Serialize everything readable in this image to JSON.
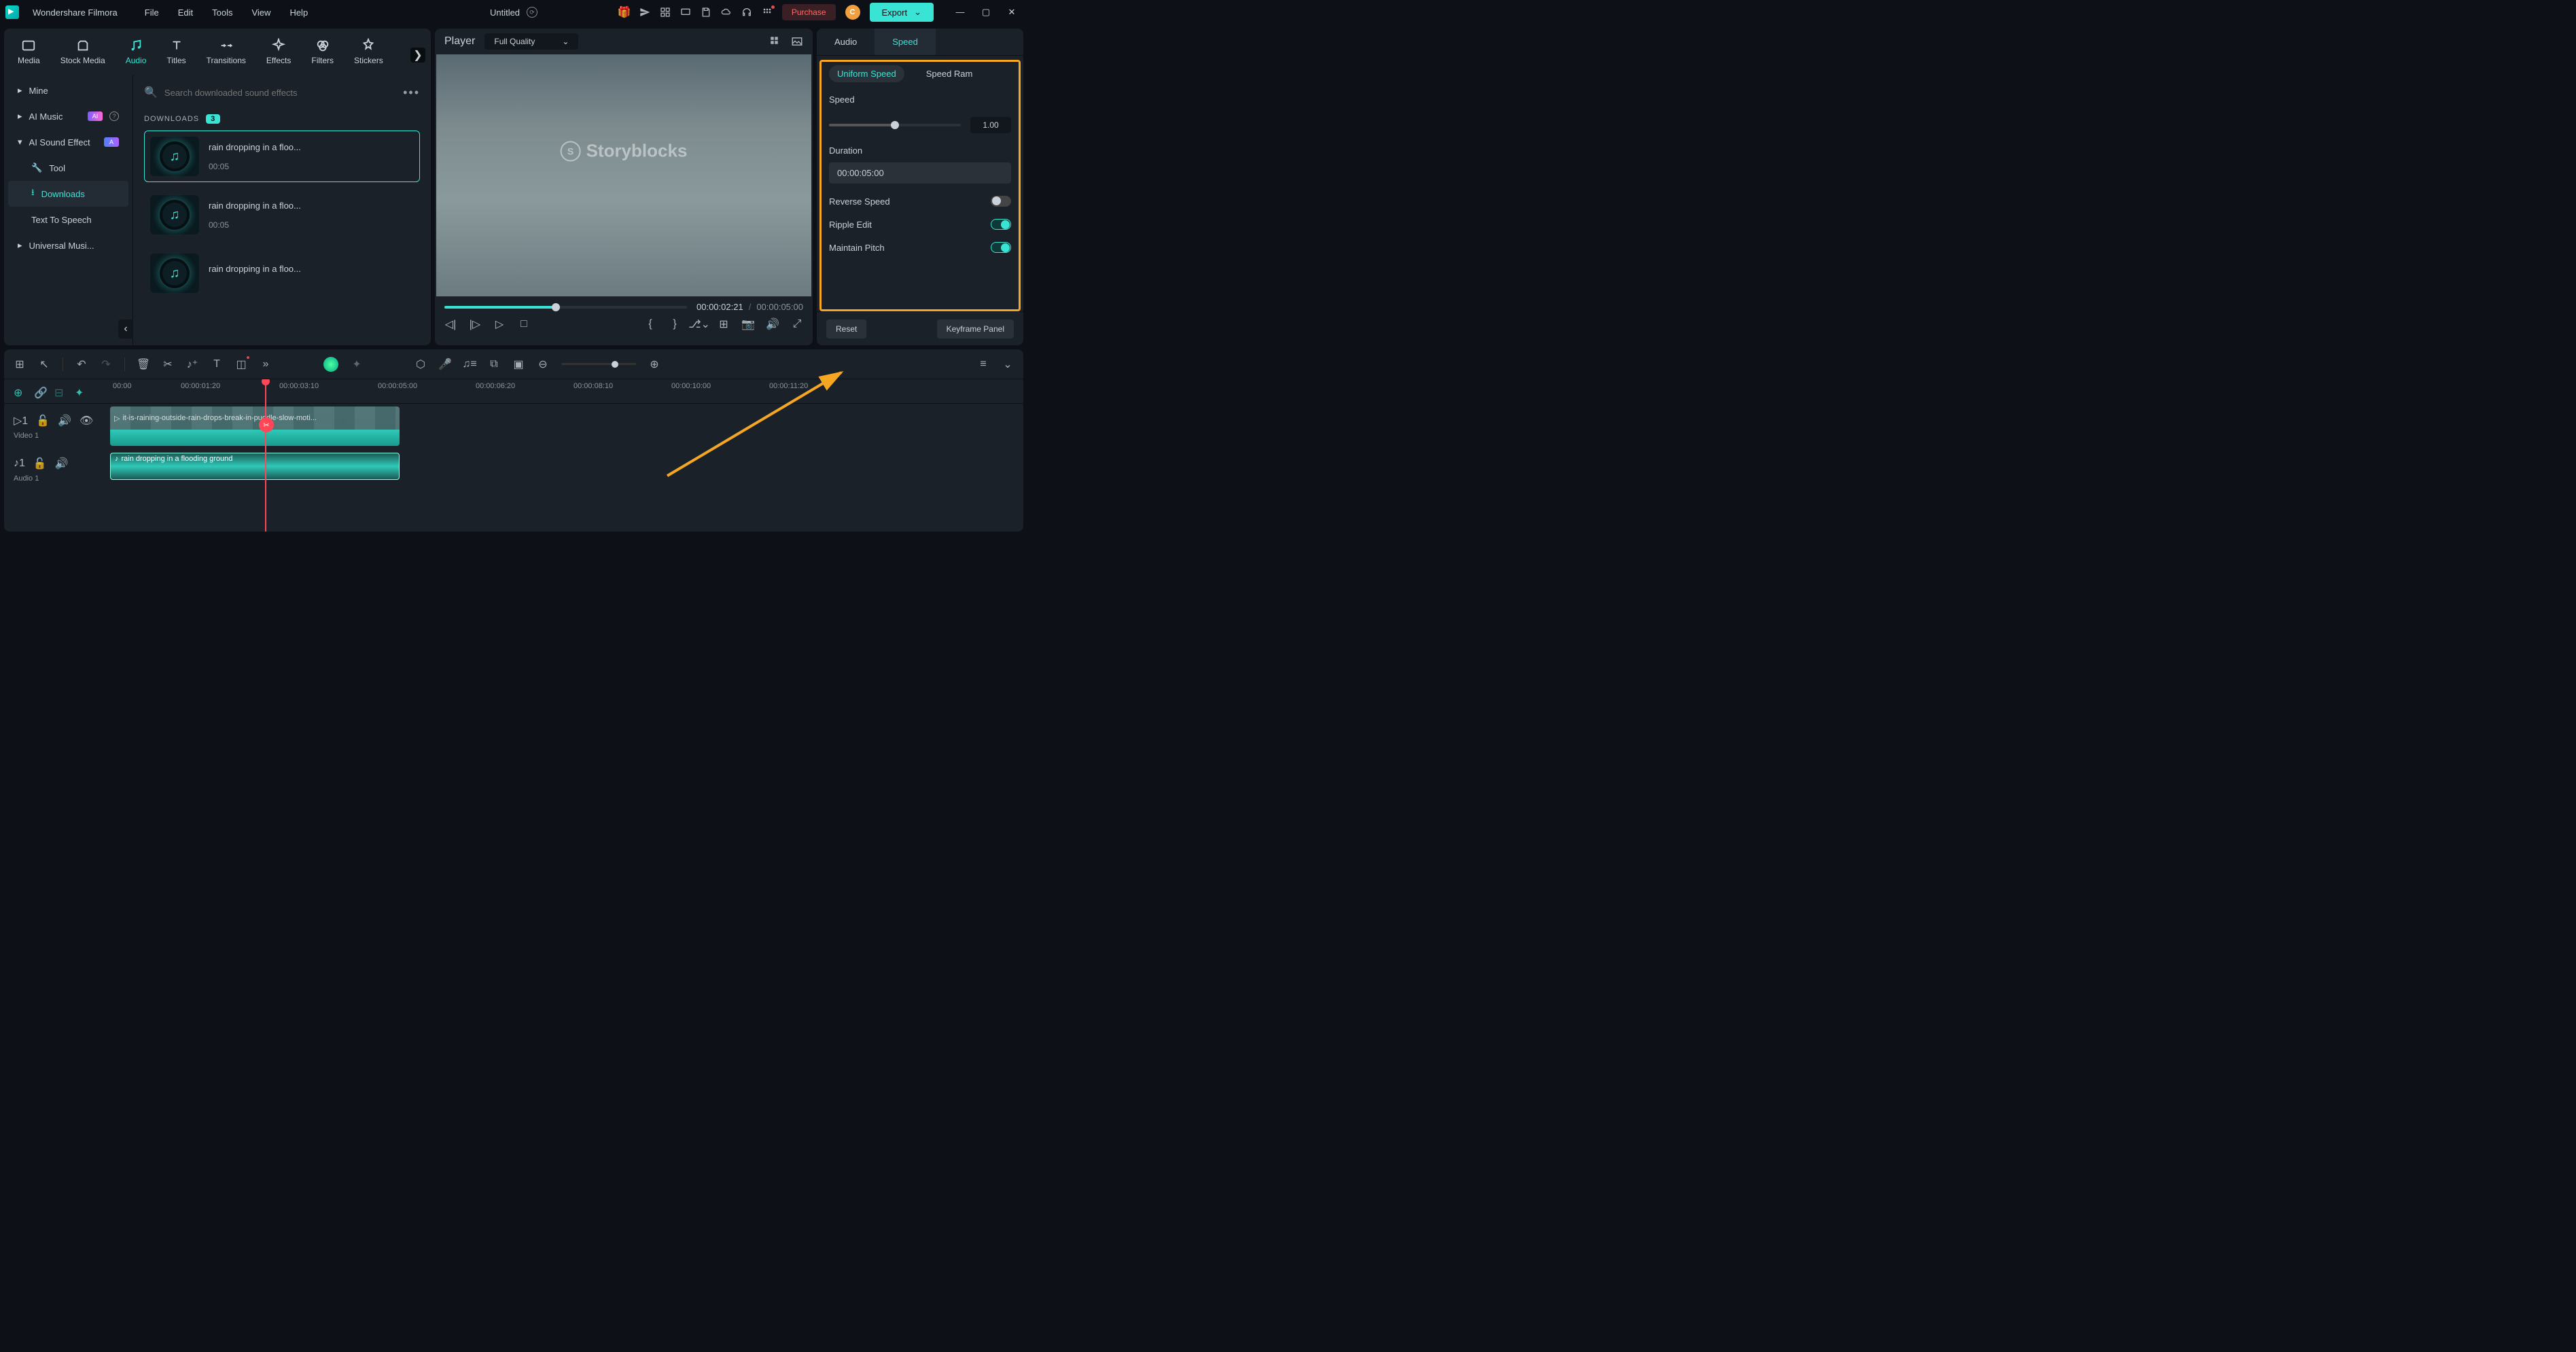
{
  "app_name": "Wondershare Filmora",
  "menus": [
    "File",
    "Edit",
    "Tools",
    "View",
    "Help"
  ],
  "doc_title": "Untitled",
  "titlebar_buttons": {
    "purchase": "Purchase",
    "export": "Export",
    "avatar_letter": "C"
  },
  "library_tabs": [
    "Media",
    "Stock Media",
    "Audio",
    "Titles",
    "Transitions",
    "Effects",
    "Filters",
    "Stickers"
  ],
  "library_active_tab": "Audio",
  "sidebar": {
    "items": [
      {
        "label": "Mine",
        "type": "arrow"
      },
      {
        "label": "AI Music",
        "type": "arrow",
        "badge": "AI",
        "help": true
      },
      {
        "label": "AI Sound Effect",
        "type": "arrow",
        "badge": "A",
        "expanded": true
      },
      {
        "label": "Tool",
        "type": "sub",
        "icon": "wrench"
      },
      {
        "label": "Downloads",
        "type": "sub",
        "icon": "download",
        "active": true
      },
      {
        "label": "Text To Speech",
        "type": "item"
      },
      {
        "label": "Universal Musi...",
        "type": "arrow"
      }
    ]
  },
  "search": {
    "placeholder": "Search downloaded sound effects"
  },
  "downloads_header": "DOWNLOADS",
  "downloads_count": "3",
  "clips": [
    {
      "title": "rain dropping in a floo...",
      "duration": "00:05",
      "selected": true
    },
    {
      "title": "rain dropping in a floo...",
      "duration": "00:05",
      "selected": false
    },
    {
      "title": "rain dropping in a floo...",
      "duration": "",
      "selected": false
    }
  ],
  "preview": {
    "header_label": "Player",
    "quality": "Full Quality",
    "watermark": "Storyblocks",
    "current_time": "00:00:02:21",
    "total_time": "00:00:05:00"
  },
  "right_panel": {
    "tabs": [
      "Audio",
      "Speed"
    ],
    "active_tab": "Speed",
    "subtabs": [
      "Uniform Speed",
      "Speed Ram"
    ],
    "active_subtab": "Uniform Speed",
    "speed_label": "Speed",
    "speed_value": "1.00",
    "duration_label": "Duration",
    "duration_value": "00:00:05:00",
    "toggles": [
      {
        "label": "Reverse Speed",
        "on": false
      },
      {
        "label": "Ripple Edit",
        "on": true
      },
      {
        "label": "Maintain Pitch",
        "on": true
      }
    ],
    "footer": {
      "reset": "Reset",
      "keyframe": "Keyframe Panel"
    }
  },
  "timeline": {
    "ruler": [
      "00:00",
      "00:00:01:20",
      "00:00:03:10",
      "00:00:05:00",
      "00:00:06:20",
      "00:00:08:10",
      "00:00:10:00",
      "00:00:11:20"
    ],
    "tracks": [
      {
        "name": "Video 1",
        "clip_label": "it-is-raining-outside-rain-drops-break-in-puddle-slow-moti..."
      },
      {
        "name": "Audio 1",
        "clip_label": "rain dropping in a flooding ground"
      }
    ]
  }
}
